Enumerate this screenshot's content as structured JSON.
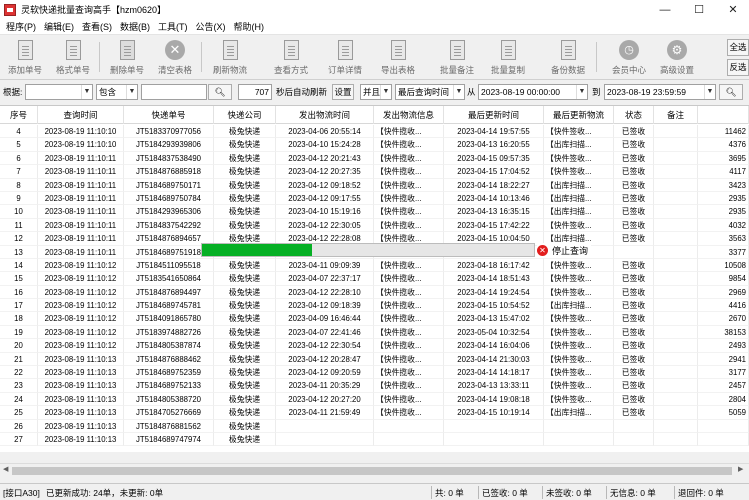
{
  "window": {
    "title": "灵软快递批量查询高手【hzm0620】",
    "controls": {
      "minimize": "—",
      "maximize": "☐",
      "close": "✕"
    }
  },
  "menu": [
    "程序(P)",
    "编辑(E)",
    "查看(S)",
    "数据(B)",
    "工具(T)",
    "公告(X)",
    "帮助(H)"
  ],
  "toolbar": {
    "buttons": [
      {
        "label": "添加单号",
        "icon": "document-icon"
      },
      {
        "label": "格式单号",
        "icon": "document-icon"
      },
      {
        "label": "删除单号",
        "icon": "delete-document-icon"
      },
      {
        "label": "清空表格",
        "icon": "clear-icon"
      },
      {
        "label": "刷新物流",
        "icon": "document-icon"
      },
      {
        "label": "查看方式",
        "icon": "document-icon"
      },
      {
        "label": "订单详情",
        "icon": "document-icon"
      },
      {
        "label": "导出表格",
        "icon": "document-icon"
      },
      {
        "label": "批量备注",
        "icon": "document-icon"
      },
      {
        "label": "批量复制",
        "icon": "document-icon"
      },
      {
        "label": "备份数据",
        "icon": "document-icon"
      },
      {
        "label": "会员中心",
        "icon": "clock-icon"
      },
      {
        "label": "高级设置",
        "icon": "gear-icon"
      }
    ],
    "side_buttons": {
      "select_all": "全选",
      "invert": "反选"
    }
  },
  "filter": {
    "label": "根据:",
    "field_select": "",
    "match_select": "包含",
    "search_input": "",
    "search_icon": "search-icon",
    "interval_value": "707",
    "interval_label": "秒后自动刷新",
    "settings_button": "设置",
    "logic_select": "并且",
    "date_field_select": "最后查询时间",
    "from_label": "从",
    "from_date": "2023-08-19 00:00:00",
    "to_label": "到",
    "to_date": "2023-08-19 23:59:59",
    "query_icon": "search-icon"
  },
  "table": {
    "columns": [
      "序号",
      "查询时间",
      "快递单号",
      "快递公司",
      "发出物流时间",
      "发出物流信息",
      "最后更新时间",
      "最后更新物流",
      "状态",
      "备注",
      ""
    ],
    "rows": [
      [
        "4",
        "2023-08-19 11:10:10",
        "JT5183370977056",
        "极兔快递",
        "2023-04-06 20:55:14",
        "【快件揽收...",
        "2023-04-14 19:57:55",
        "【快件签收...",
        "已签收",
        "",
        "11462"
      ],
      [
        "5",
        "2023-08-19 11:10:10",
        "JT5184293939806",
        "极兔快递",
        "2023-04-10 15:24:28",
        "【快件揽收...",
        "2023-04-13 16:20:55",
        "【出库扫描...",
        "已签收",
        "",
        "4376"
      ],
      [
        "6",
        "2023-08-19 11:10:11",
        "JT5184837538490",
        "极兔快递",
        "2023-04-12 20:21:43",
        "【快件揽收...",
        "2023-04-15 09:57:35",
        "【快件签收...",
        "已签收",
        "",
        "3695"
      ],
      [
        "7",
        "2023-08-19 11:10:11",
        "JT5184876885918",
        "极兔快递",
        "2023-04-12 20:27:35",
        "【快件揽收...",
        "2023-04-15 17:04:52",
        "【快件签收...",
        "已签收",
        "",
        "4117"
      ],
      [
        "8",
        "2023-08-19 11:10:11",
        "JT5184689750171",
        "极兔快递",
        "2023-04-12 09:18:52",
        "【快件揽收...",
        "2023-04-14 18:22:27",
        "【出库扫描...",
        "已签收",
        "",
        "3423"
      ],
      [
        "9",
        "2023-08-19 11:10:11",
        "JT5184689750784",
        "极兔快递",
        "2023-04-12 09:17:55",
        "【快件揽收...",
        "2023-04-14 10:13:46",
        "【出库扫描...",
        "已签收",
        "",
        "2935"
      ],
      [
        "10",
        "2023-08-19 11:10:11",
        "JT5184293965306",
        "极兔快递",
        "2023-04-10 15:19:16",
        "【快件揽收...",
        "2023-04-13 16:35:15",
        "【出库扫描...",
        "已签收",
        "",
        "2935"
      ],
      [
        "11",
        "2023-08-19 11:10:11",
        "JT5184837542292",
        "极兔快递",
        "2023-04-12 22:30:05",
        "【快件揽收...",
        "2023-04-15 17:42:22",
        "【快件签收...",
        "已签收",
        "",
        "4032"
      ],
      [
        "12",
        "2023-08-19 11:10:11",
        "JT5184876894657",
        "极兔快递",
        "2023-04-12 22:28:08",
        "【快件揽收...",
        "2023-04-15 10:04:50",
        "【出库扫描...",
        "已签收",
        "",
        "3563"
      ],
      [
        "13",
        "2023-08-19 11:10:11",
        "JT5184689751918",
        "极兔快递",
        "",
        "",
        "",
        "",
        "",
        "",
        "3377"
      ],
      [
        "14",
        "2023-08-19 11:10:12",
        "JT5184511095518",
        "极兔快递",
        "2023-04-11 09:09:39",
        "【快件揽收...",
        "2023-04-18 16:17:42",
        "【快件签收...",
        "已签收",
        "",
        "10508"
      ],
      [
        "15",
        "2023-08-19 11:10:12",
        "JT5183541650864",
        "极兔快递",
        "2023-04-07 22:37:17",
        "【快件揽收...",
        "2023-04-14 18:51:43",
        "【快件签收...",
        "已签收",
        "",
        "9854"
      ],
      [
        "16",
        "2023-08-19 11:10:12",
        "JT5184876894497",
        "极兔快递",
        "2023-04-12 22:28:10",
        "【快件揽收...",
        "2023-04-14 19:24:54",
        "【快件签收...",
        "已签收",
        "",
        "2969"
      ],
      [
        "17",
        "2023-08-19 11:10:12",
        "JT5184689745781",
        "极兔快递",
        "2023-04-12 09:18:39",
        "【快件揽收...",
        "2023-04-15 10:54:52",
        "【出库扫描...",
        "已签收",
        "",
        "4416"
      ],
      [
        "18",
        "2023-08-19 11:10:12",
        "JT5184091865780",
        "极兔快递",
        "2023-04-09 16:46:44",
        "【快件揽收...",
        "2023-04-13 15:47:02",
        "【快件签收...",
        "已签收",
        "",
        "2670"
      ],
      [
        "19",
        "2023-08-19 11:10:12",
        "JT5183974882726",
        "极兔快递",
        "2023-04-07 22:41:46",
        "【快件揽收...",
        "2023-05-04 10:32:54",
        "【快件签收...",
        "已签收",
        "",
        "38153"
      ],
      [
        "20",
        "2023-08-19 11:10:12",
        "JT5184805387874",
        "极兔快递",
        "2023-04-12 22:30:54",
        "【快件揽收...",
        "2023-04-14 16:04:06",
        "【快件签收...",
        "已签收",
        "",
        "2493"
      ],
      [
        "21",
        "2023-08-19 11:10:13",
        "JT5184876888462",
        "极兔快递",
        "2023-04-12 20:28:47",
        "【快件揽收...",
        "2023-04-14 21:30:03",
        "【快件签收...",
        "已签收",
        "",
        "2941"
      ],
      [
        "22",
        "2023-08-19 11:10:13",
        "JT5184689752359",
        "极兔快递",
        "2023-04-12 09:20:59",
        "【快件揽收...",
        "2023-04-14 14:18:17",
        "【快件签收...",
        "已签收",
        "",
        "3177"
      ],
      [
        "23",
        "2023-08-19 11:10:13",
        "JT5184689752133",
        "极兔快递",
        "2023-04-11 20:35:29",
        "【快件揽收...",
        "2023-04-13 13:33:11",
        "【快件签收...",
        "已签收",
        "",
        "2457"
      ],
      [
        "24",
        "2023-08-19 11:10:13",
        "JT5184805388720",
        "极兔快递",
        "2023-04-12 20:27:20",
        "【快件揽收...",
        "2023-04-14 19:08:18",
        "【快件签收...",
        "已签收",
        "",
        "2804"
      ],
      [
        "25",
        "2023-08-19 11:10:13",
        "JT5184705276669",
        "极兔快递",
        "2023-04-11 21:59:49",
        "【快件揽收...",
        "2023-04-15 10:19:14",
        "【出库扫描...",
        "已签收",
        "",
        "5059"
      ],
      [
        "26",
        "2023-08-19 11:10:13",
        "JT5184876881562",
        "极兔快递",
        "",
        "",
        "",
        "",
        "",
        "",
        ""
      ],
      [
        "27",
        "2023-08-19 11:10:13",
        "JT5184689747974",
        "极兔快递",
        "",
        "",
        "",
        "",
        "",
        "",
        ""
      ]
    ]
  },
  "progress": {
    "value": 0.33,
    "stop_label": "停止查询",
    "color": "#06b025"
  },
  "status": {
    "interface": "[接口A30]",
    "updated": "已更新成功: 24单，未更新: 0单",
    "total": "共: 0 单",
    "signed": "已签收: 0 单",
    "unsigned": "未签收: 0 单",
    "no_info": "无信息: 0 单",
    "returned": "退回件: 0 单"
  }
}
